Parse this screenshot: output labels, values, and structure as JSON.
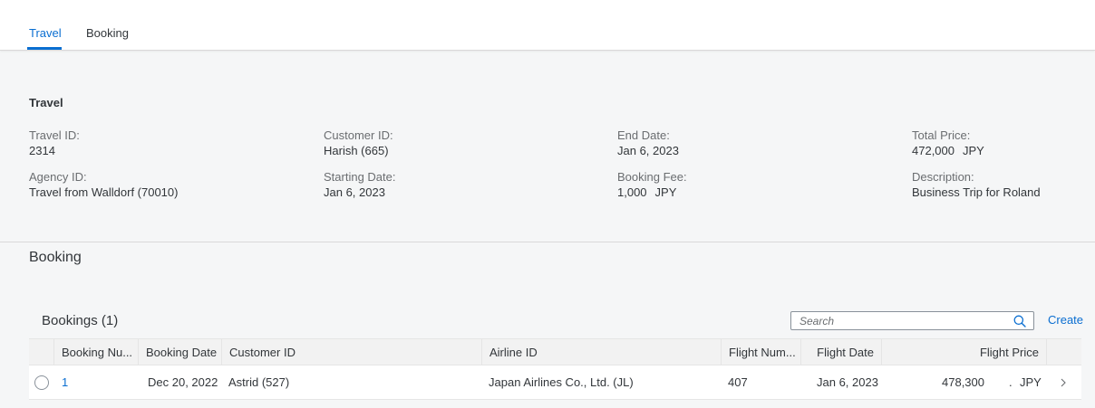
{
  "tabs": [
    {
      "label": "Travel",
      "active": true
    },
    {
      "label": "Booking",
      "active": false
    }
  ],
  "travel": {
    "title": "Travel",
    "fields": {
      "travel_id": {
        "label": "Travel ID:",
        "value": "2314"
      },
      "agency_id": {
        "label": "Agency ID:",
        "value": "Travel from Walldorf (70010)"
      },
      "customer_id": {
        "label": "Customer ID:",
        "value": "Harish (665)"
      },
      "starting_date": {
        "label": "Starting Date:",
        "value": "Jan 6, 2023"
      },
      "end_date": {
        "label": "End Date:",
        "value": "Jan 6, 2023"
      },
      "booking_fee": {
        "label": "Booking Fee:",
        "value": "1,000",
        "currency": "JPY"
      },
      "total_price": {
        "label": "Total Price:",
        "value": "472,000",
        "currency": "JPY"
      },
      "description": {
        "label": "Description:",
        "value": "Business Trip for Roland"
      }
    }
  },
  "booking_section": {
    "title": "Booking",
    "table_title": "Bookings (1)",
    "search_placeholder": "Search",
    "create_label": "Create",
    "columns": [
      "Booking Nu...",
      "Booking Date",
      "Customer ID",
      "Airline ID",
      "Flight Num...",
      "Flight Date",
      "Flight Price"
    ],
    "rows": [
      {
        "booking_number": "1",
        "booking_date": "Dec 20, 2022",
        "customer_id": "Astrid (527)",
        "airline_id": "Japan Airlines Co., Ltd. (JL)",
        "flight_number": "407",
        "flight_date": "Jan 6, 2023",
        "flight_price": "478,300",
        "flight_price_sep": ".",
        "currency": "JPY"
      }
    ]
  },
  "colors": {
    "accent": "#0a6ed1",
    "background": "#f5f6f7",
    "text": "#32363a",
    "label": "#6a6d70"
  },
  "icons": {
    "search": "search-icon",
    "row_nav": "chevron-right-icon",
    "row_select": "radio-button-icon"
  }
}
